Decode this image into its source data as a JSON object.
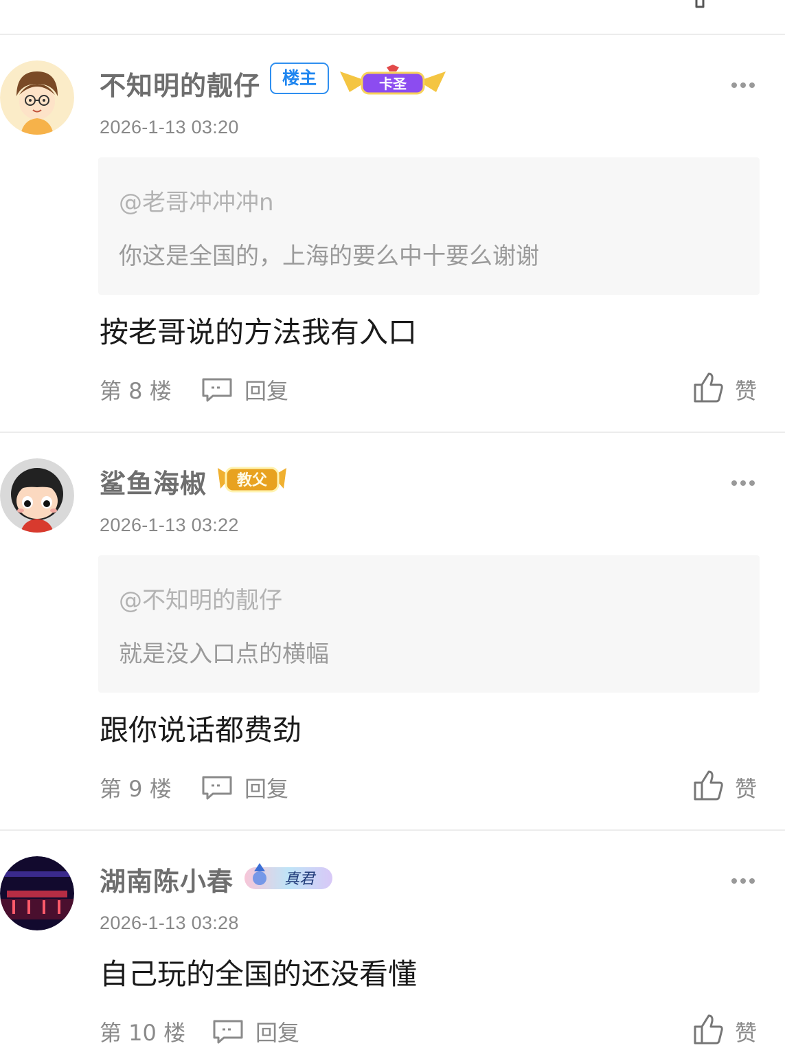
{
  "top": {
    "like_label": "赞"
  },
  "posts": [
    {
      "username": "不知明的靓仔",
      "owner_tag": "楼主",
      "level_badge": "卡圣",
      "timestamp": "2026-1-13 03:20",
      "quote": {
        "author": "@老哥冲冲冲n",
        "text": "你这是全国的，上海的要么中十要么谢谢"
      },
      "content": "按老哥说的方法我有入口",
      "floor": "第 8 楼",
      "reply_label": "回复",
      "like_label": "赞"
    },
    {
      "username": "鲨鱼海椒",
      "level_badge": "教父",
      "timestamp": "2026-1-13 03:22",
      "quote": {
        "author": "@不知明的靓仔",
        "text": "就是没入口点的横幅"
      },
      "content": "跟你说话都费劲",
      "floor": "第 9 楼",
      "reply_label": "回复",
      "like_label": "赞"
    },
    {
      "username": "湖南陈小春",
      "level_badge": "真君",
      "timestamp": "2026-1-13 03:28",
      "content": "自己玩的全国的还没看懂",
      "floor": "第 10 楼",
      "reply_label": "回复",
      "like_label": "赞"
    }
  ],
  "colors": {
    "owner_tag": "#1f86f0",
    "meta_text": "#8a8a8a",
    "quote_bg": "#f7f7f7",
    "divider": "#ececec"
  },
  "icons": [
    "more-icon",
    "comment-icon",
    "thumbs-up-icon"
  ]
}
